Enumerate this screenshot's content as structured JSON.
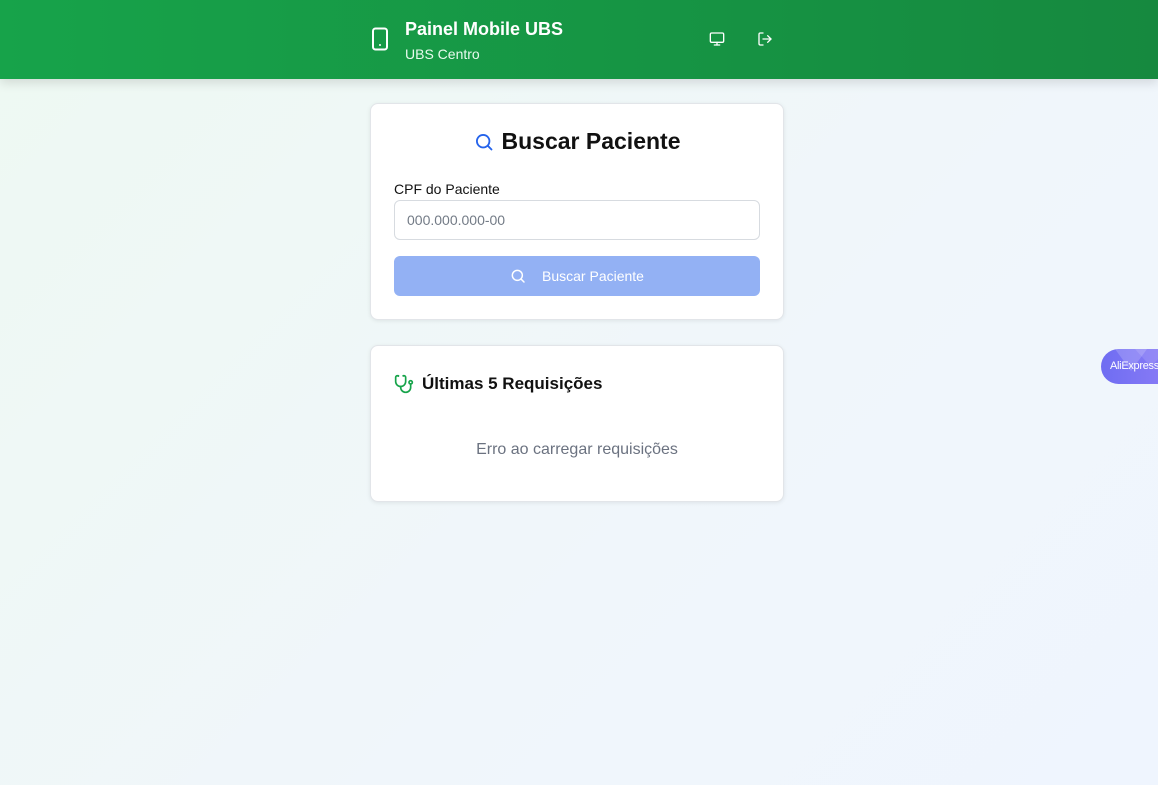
{
  "header": {
    "title": "Painel Mobile UBS",
    "unit": "UBS Centro",
    "icons": {
      "brand": "smartphone-icon",
      "desktop": "monitor-icon",
      "logout": "logout-icon"
    }
  },
  "search": {
    "title": "Buscar Paciente",
    "cpf_label": "CPF do Paciente",
    "cpf_placeholder": "000.000.000-00",
    "cpf_value": "",
    "button_label": "Buscar Paciente",
    "button_color": "#93b1f4"
  },
  "requests": {
    "title": "Últimas 5 Requisições",
    "error_message": "Erro ao carregar requisições"
  },
  "extension": {
    "label": "AliExpress"
  },
  "colors": {
    "header_green": "#17a34a",
    "search_icon_blue": "#2563eb",
    "stethoscope_green": "#16a34a"
  }
}
